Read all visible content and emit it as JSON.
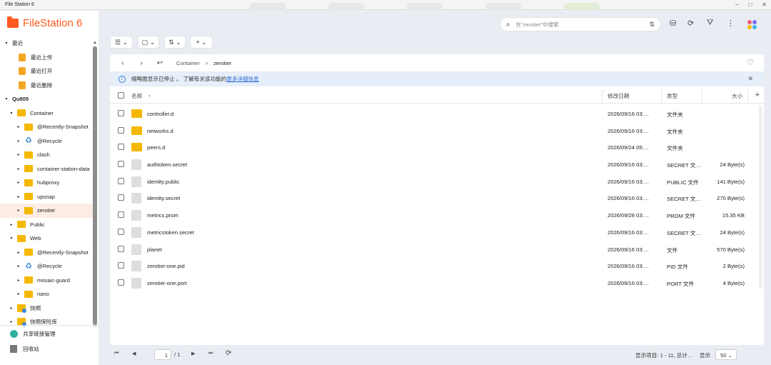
{
  "window": {
    "title": "File Station 6"
  },
  "app": {
    "name": "FileStation 6"
  },
  "sidebar": {
    "recent_section": "最近",
    "recent_items": [
      "最近上传",
      "最近打开",
      "最近删除"
    ],
    "device": "Qu805",
    "folders": [
      {
        "label": "Container",
        "level": 1,
        "type": "folder"
      },
      {
        "label": "@Recently-Snapshot",
        "level": 2,
        "type": "folder"
      },
      {
        "label": "@Recycle",
        "level": 2,
        "type": "recycle"
      },
      {
        "label": "clash",
        "level": 2,
        "type": "folder"
      },
      {
        "label": "container-station-data",
        "level": 2,
        "type": "folder"
      },
      {
        "label": "hubproxy",
        "level": 2,
        "type": "folder"
      },
      {
        "label": "upsnap",
        "level": 2,
        "type": "folder"
      },
      {
        "label": "zerotier",
        "level": 2,
        "type": "folder",
        "selected": true
      },
      {
        "label": "Public",
        "level": 1,
        "type": "folder"
      },
      {
        "label": "Web",
        "level": 1,
        "type": "folder"
      },
      {
        "label": "@Recently-Snapshot",
        "level": 2,
        "type": "folder"
      },
      {
        "label": "@Recycle",
        "level": 2,
        "type": "recycle"
      },
      {
        "label": "mosaic-guard",
        "level": 2,
        "type": "folder"
      },
      {
        "label": "nano",
        "level": 2,
        "type": "folder"
      },
      {
        "label": "快照",
        "level": 1,
        "type": "snapshot"
      },
      {
        "label": "快照保险库",
        "level": 1,
        "type": "snapshot"
      }
    ],
    "share_link": "共享链接管理",
    "recycle_bin": "回收站"
  },
  "toolbar": {
    "view": "☰ ⌄",
    "layout": "▢ ⌄",
    "sort": "⇅ ⌄",
    "add": "+ ⌄"
  },
  "search": {
    "placeholder": "在“zerotier”中搜索"
  },
  "breadcrumb": {
    "root": "Container",
    "current": "zerotier"
  },
  "banner": {
    "text": "缩略图显示已停止 。 了解有关该功能的",
    "link": "更多详细信息"
  },
  "table": {
    "headers": {
      "name": "名称",
      "date": "修改日期",
      "type": "类型",
      "size": "大小"
    },
    "rows": [
      {
        "name": "controller.d",
        "date": "2026/09/16 03:…",
        "type": "文件夹",
        "size": "",
        "kind": "folder"
      },
      {
        "name": "networks.d",
        "date": "2026/09/16 03:…",
        "type": "文件夹",
        "size": "",
        "kind": "folder"
      },
      {
        "name": "peers.d",
        "date": "2026/09/24 05:…",
        "type": "文件夹",
        "size": "",
        "kind": "folder"
      },
      {
        "name": "authtoken.secret",
        "date": "2026/09/16 03:…",
        "type": "SECRET 文…",
        "size": "24 Byte(s)",
        "kind": "file"
      },
      {
        "name": "identity.public",
        "date": "2026/09/16 03:…",
        "type": "PUBLIC 文件",
        "size": "141 Byte(s)",
        "kind": "file"
      },
      {
        "name": "identity.secret",
        "date": "2026/09/16 03:…",
        "type": "SECRET 文…",
        "size": "270 Byte(s)",
        "kind": "file"
      },
      {
        "name": "metrics.prom",
        "date": "2026/09/28 03:…",
        "type": "PROM 文件",
        "size": "15.35 KB",
        "kind": "file"
      },
      {
        "name": "metricstoken.secret",
        "date": "2026/09/16 03:…",
        "type": "SECRET 文…",
        "size": "24 Byte(s)",
        "kind": "file"
      },
      {
        "name": "planet",
        "date": "2026/09/16 03:…",
        "type": "文件",
        "size": "570 Byte(s)",
        "kind": "file"
      },
      {
        "name": "zerotier-one.pid",
        "date": "2026/09/16 03:…",
        "type": "PID 文件",
        "size": "2 Byte(s)",
        "kind": "file"
      },
      {
        "name": "zerotier-one.port",
        "date": "2026/09/16 03:…",
        "type": "PORT 文件",
        "size": "4 Byte(s)",
        "kind": "file"
      }
    ]
  },
  "footer": {
    "page": "1",
    "total_pages": "/ 1",
    "display": "显示项目: 1 - 11, 总计…",
    "show_label": "显示",
    "per_page": "50"
  },
  "colors": {
    "accent": "#ff5a1f",
    "folder": "#f5b800",
    "link": "#2f6fd6"
  }
}
